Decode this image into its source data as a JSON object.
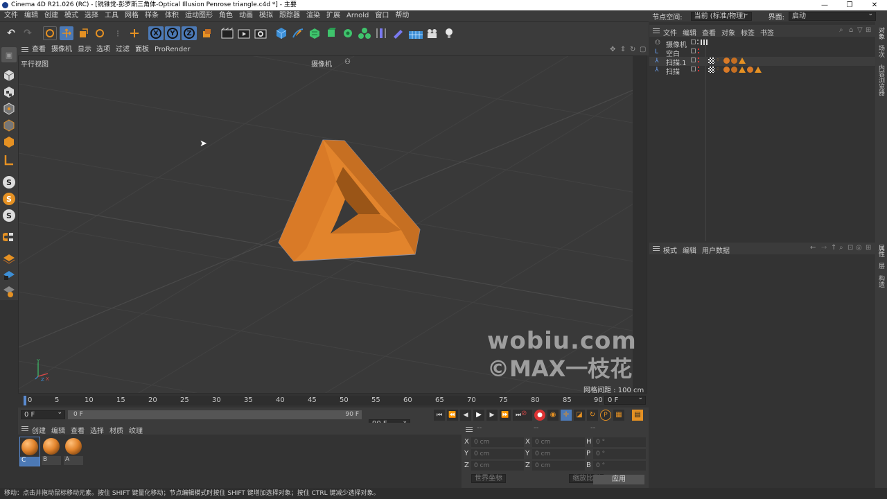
{
  "window": {
    "title": "Cinema 4D R21.026 (RC) - [锐锥觉-彭罗斯三角体-Optical Illusion Penrose triangle.c4d *] - 主要",
    "controls": [
      "—",
      "❐",
      "✕"
    ]
  },
  "menubar": {
    "items": [
      "文件",
      "编辑",
      "创建",
      "模式",
      "选择",
      "工具",
      "网格",
      "样条",
      "体积",
      "运动图形",
      "角色",
      "动画",
      "模拟",
      "跟踪器",
      "渲染",
      "扩展",
      "Arnold",
      "窗口",
      "帮助"
    ],
    "node_space_label": "节点空间:",
    "node_space_value": "当前 (标准/物理)",
    "layout_label": "界面:",
    "layout_value": "启动"
  },
  "toolbar": {
    "axis_x": "X",
    "axis_y": "Y",
    "axis_z": "Z",
    "colors": {
      "active": "#4c79b5",
      "orange": "#e59123",
      "green": "#3fc46c",
      "blue": "#3d8fd6"
    }
  },
  "viewport": {
    "menu": [
      "查看",
      "摄像机",
      "显示",
      "选项",
      "过滤",
      "面板",
      "ProRender"
    ],
    "view_label": "平行视图",
    "camera_label": "摄像机",
    "grid_spacing": "网格间距 : 100 cm",
    "watermark_line1": "wobiu.com",
    "watermark_line2": "©MAX一枝花",
    "object_colors": {
      "light": "#e2842c",
      "mid": "#c66f22",
      "dark": "#9a5517"
    }
  },
  "timeline": {
    "ticks": [
      "0",
      "5",
      "10",
      "15",
      "20",
      "25",
      "30",
      "35",
      "40",
      "45",
      "50",
      "55",
      "60",
      "65",
      "70",
      "75",
      "80",
      "85",
      "90"
    ],
    "current_frame": "0 F",
    "start_field": "0 F",
    "range_start": "0 F",
    "range_end": "90 F",
    "end_field": "90 F"
  },
  "materials": {
    "menu": [
      "创建",
      "编辑",
      "查看",
      "选择",
      "材质",
      "纹理"
    ],
    "items": [
      "C",
      "B",
      "A"
    ]
  },
  "coords": {
    "header": [
      "--",
      "--",
      "--"
    ],
    "rows": [
      {
        "a": "X",
        "av": "0 cm",
        "b": "X",
        "bv": "0 cm",
        "c": "H",
        "cv": "0 °"
      },
      {
        "a": "Y",
        "av": "0 cm",
        "b": "Y",
        "bv": "0 cm",
        "c": "P",
        "cv": "0 °"
      },
      {
        "a": "Z",
        "av": "0 cm",
        "b": "Z",
        "bv": "0 cm",
        "c": "B",
        "cv": "0 °"
      }
    ],
    "world_label": "世界坐标",
    "scale_label": "缩放比例",
    "apply_label": "应用"
  },
  "objects": {
    "menu": [
      "文件",
      "编辑",
      "查看",
      "对象",
      "标签",
      "书签"
    ],
    "items": [
      "摄像机",
      "空白",
      "扫描.1",
      "扫描"
    ]
  },
  "attributes": {
    "menu": [
      "模式",
      "编辑",
      "用户数据"
    ]
  },
  "right_tabs": {
    "top": [
      "对象",
      "场次",
      "内容浏览器"
    ],
    "bottom": [
      "属性",
      "层",
      "构造"
    ]
  },
  "status": {
    "text": "移动：点击并拖动鼠标移动元素。按住 SHIFT 键量化移动；节点编辑模式时按住 SHIFT 键增加选择对象；按住 CTRL 键减少选择对象。"
  }
}
